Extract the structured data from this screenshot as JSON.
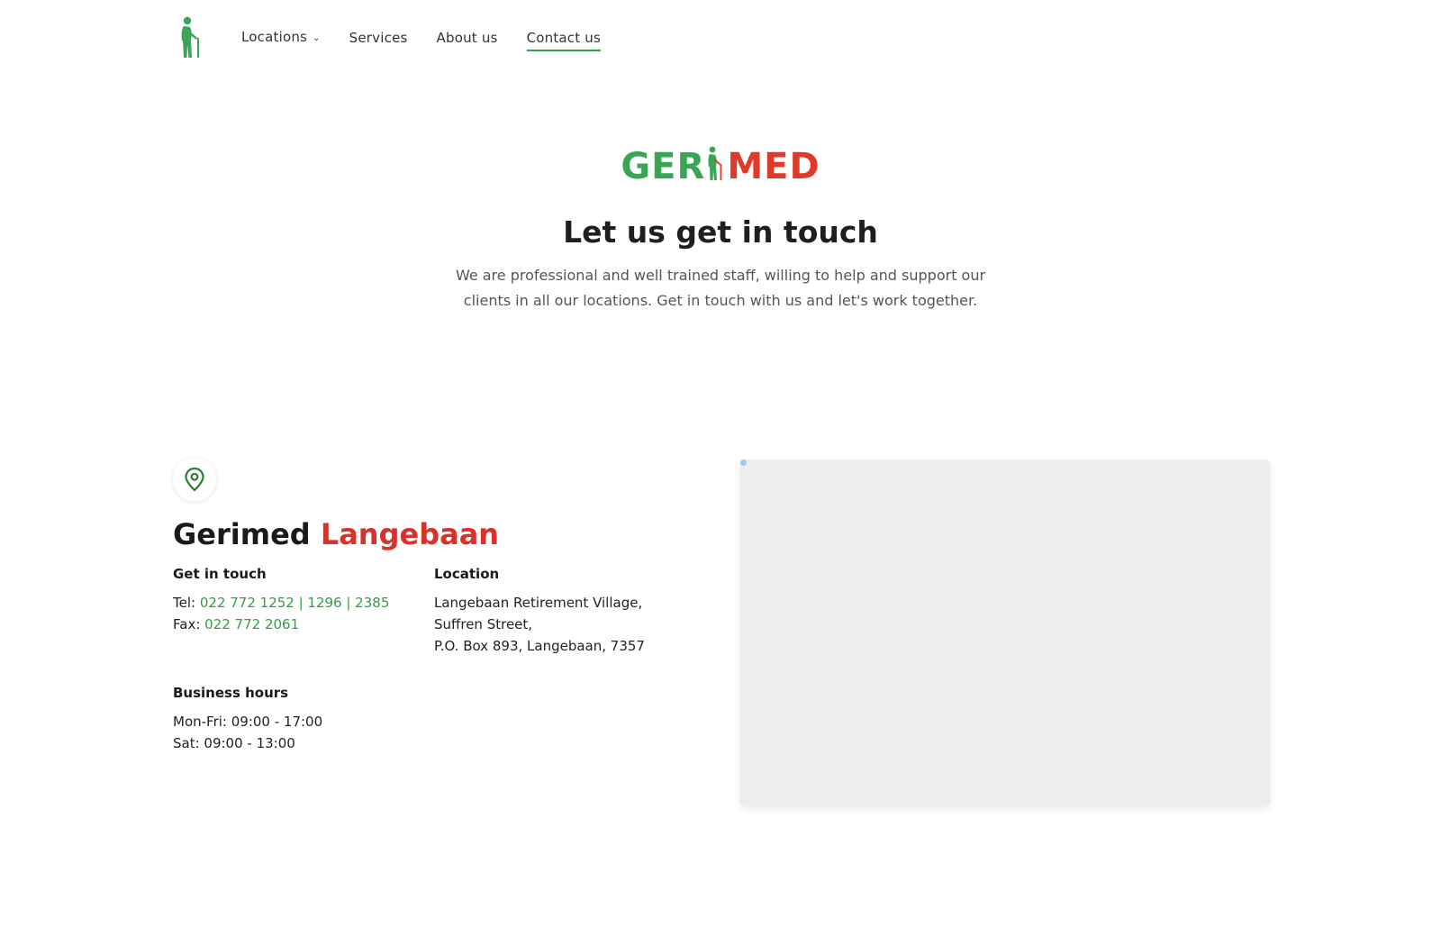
{
  "nav": {
    "items": [
      {
        "label": "Locations",
        "has_dropdown": true,
        "active": false
      },
      {
        "label": "Services",
        "has_dropdown": false,
        "active": false
      },
      {
        "label": "About us",
        "has_dropdown": false,
        "active": false
      },
      {
        "label": "Contact us",
        "has_dropdown": false,
        "active": true
      }
    ]
  },
  "hero": {
    "brand_left": "GER",
    "brand_right": "MED",
    "title": "Let us get in touch",
    "text": "We are professional and well trained staff, willing to help and support our clients in all our locations. Get in touch with us and let's work together."
  },
  "contact": {
    "title_main": "Gerimed",
    "title_accent": "Langebaan",
    "get_in_touch": {
      "heading": "Get in touch",
      "tel_label": "Tel:",
      "tel_value": "022 772 1252 | 1296 | 2385",
      "fax_label": "Fax:",
      "fax_value": "022 772 2061"
    },
    "location": {
      "heading": "Location",
      "lines": [
        "Langebaan Retirement Village,",
        "Suffren Street,",
        "P.O. Box 893, Langebaan, 7357"
      ]
    },
    "hours": {
      "heading": "Business hours",
      "lines": [
        "Mon-Fri: 09:00 - 17:00",
        "Sat: 09:00 - 13:00"
      ]
    }
  },
  "colors": {
    "brand_green": "#3aa655",
    "brand_red": "#e03a2a",
    "link_green": "#2f9e44"
  },
  "icons": {
    "logo": "elderly-person-with-cane-icon",
    "location": "map-pin-icon",
    "dropdown": "chevron-down-icon"
  }
}
